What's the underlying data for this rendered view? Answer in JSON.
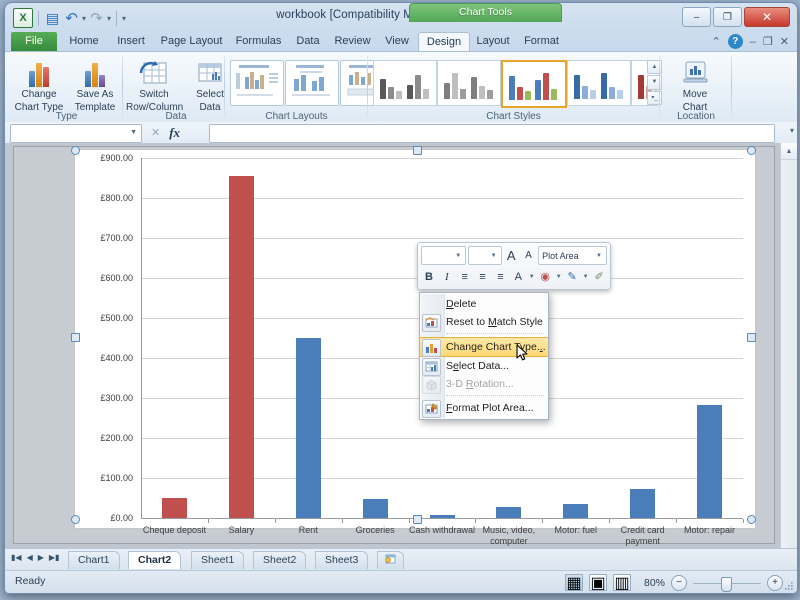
{
  "window": {
    "title": "workbook  [Compatibility Mode]  -  Microsoft Excel",
    "contextual_tab_group": "Chart Tools",
    "quick_access": [
      {
        "name": "excel-logo",
        "glyph": "X"
      },
      {
        "name": "save-icon",
        "glyph": "▤"
      },
      {
        "name": "undo-icon",
        "glyph": "↶"
      },
      {
        "name": "redo-icon",
        "glyph": "↷"
      },
      {
        "name": "customize-qat-icon",
        "glyph": "▾"
      }
    ],
    "controls": [
      {
        "name": "minimize-button",
        "glyph": "–"
      },
      {
        "name": "restore-button",
        "glyph": "❐"
      },
      {
        "name": "close-button",
        "glyph": "✕"
      }
    ],
    "ribbon_right": [
      {
        "name": "minimize-ribbon-icon",
        "glyph": "⌃"
      },
      {
        "name": "help-icon",
        "glyph": "?"
      },
      {
        "name": "window-minimize-icon",
        "glyph": "–"
      },
      {
        "name": "window-restore-icon",
        "glyph": "❐"
      },
      {
        "name": "window-close-icon",
        "glyph": "✕"
      }
    ]
  },
  "tabs": [
    {
      "label": "File",
      "state": "file"
    },
    {
      "label": "Home",
      "state": "normal"
    },
    {
      "label": "Insert",
      "state": "normal"
    },
    {
      "label": "Page Layout",
      "state": "normal"
    },
    {
      "label": "Formulas",
      "state": "normal"
    },
    {
      "label": "Data",
      "state": "normal"
    },
    {
      "label": "Review",
      "state": "normal"
    },
    {
      "label": "View",
      "state": "normal"
    },
    {
      "label": "Design",
      "state": "active"
    },
    {
      "label": "Layout",
      "state": "normal"
    },
    {
      "label": "Format",
      "state": "normal"
    }
  ],
  "ribbon": {
    "groups": [
      {
        "label": "Type",
        "buttons": [
          {
            "name": "change-chart-type-button",
            "line1": "Change",
            "line2": "Chart Type"
          },
          {
            "name": "save-as-template-button",
            "line1": "Save As",
            "line2": "Template"
          }
        ]
      },
      {
        "label": "Data",
        "buttons": [
          {
            "name": "switch-row-column-button",
            "line1": "Switch",
            "line2": "Row/Column"
          },
          {
            "name": "select-data-button",
            "line1": "Select",
            "line2": "Data"
          }
        ]
      },
      {
        "label": "Chart Layouts",
        "buttons": []
      },
      {
        "label": "Chart Styles",
        "buttons": []
      },
      {
        "label": "Location",
        "buttons": [
          {
            "name": "move-chart-button",
            "line1": "Move",
            "line2": "Chart"
          }
        ]
      }
    ]
  },
  "formula_bar": {
    "name_box_value": "",
    "formula_value": "",
    "fx_label": "fx",
    "cancel_glyph": "✕",
    "enter_glyph": "✓",
    "expand_glyph": "▾"
  },
  "mini_toolbar": {
    "font_name": "",
    "font_size": "",
    "grow_font": "A",
    "shrink_font": "A",
    "shape_selector": "Plot Area",
    "bold": "B",
    "italic": "I",
    "align_left": "≡",
    "align_center": "≡",
    "align_right": "≡",
    "font_color": "A",
    "fill_color": "◉",
    "shape_outline": "✎",
    "format_painter": "✐"
  },
  "context_menu": {
    "items": [
      {
        "name": "menu-item-delete",
        "label": "Delete",
        "accel_index": 0,
        "icon": "",
        "state": "normal",
        "separator_after": false
      },
      {
        "name": "menu-item-reset-to-match-style",
        "label": "Reset to Match Style",
        "accel_index": 9,
        "icon": "reset-style-icon",
        "state": "normal",
        "separator_after": true
      },
      {
        "name": "menu-item-change-chart-type",
        "label": "Change Chart Type...",
        "accel_index": 18,
        "icon": "chart-type-icon",
        "state": "highlighted",
        "separator_after": false
      },
      {
        "name": "menu-item-select-data",
        "label": "Select Data...",
        "accel_index": 1,
        "icon": "select-data-icon",
        "state": "normal",
        "separator_after": false
      },
      {
        "name": "menu-item-3d-rotation",
        "label": "3-D Rotation...",
        "accel_index": 4,
        "icon": "cube-icon",
        "state": "disabled",
        "separator_after": true
      },
      {
        "name": "menu-item-format-plot-area",
        "label": "Format Plot Area...",
        "accel_index": 0,
        "icon": "format-icon",
        "state": "normal",
        "separator_after": false
      }
    ]
  },
  "chart_data": {
    "type": "bar",
    "title": "",
    "xlabel": "",
    "ylabel": "",
    "ylim": [
      0,
      900
    ],
    "ytick_step": 100,
    "grid": true,
    "legend": "none",
    "currency_symbol": "£",
    "ytick_labels": [
      "£900.00",
      "£800.00",
      "£700.00",
      "£600.00",
      "£500.00",
      "£400.00",
      "£300.00",
      "£200.00",
      "£100.00",
      "£0.00"
    ],
    "categories": [
      "Cheque deposit",
      "Salary",
      "Rent",
      "Groceries",
      "Cash withdrawal",
      "Music, video, computer",
      "Motor: fuel",
      "Credit card payment",
      "Motor: repair"
    ],
    "values": [
      50,
      855,
      450,
      48,
      8,
      27,
      36,
      72,
      282
    ],
    "point_colors": [
      "#c0504d",
      "#c0504d",
      "#4a7ebb",
      "#4a7ebb",
      "#4a7ebb",
      "#4a7ebb",
      "#4a7ebb",
      "#4a7ebb",
      "#4a7ebb"
    ],
    "colors": {
      "positive": "#4a7ebb",
      "negative": "#c0504d",
      "gridline": "#d4d4d4",
      "axis": "#9a9a9a"
    }
  },
  "sheet_tabs": {
    "nav": [
      "◀▐",
      "◀",
      "▶",
      "▌▶"
    ],
    "tabs": [
      {
        "label": "Chart1",
        "active": false
      },
      {
        "label": "Chart2",
        "active": true
      },
      {
        "label": "Sheet1",
        "active": false
      },
      {
        "label": "Sheet2",
        "active": false
      },
      {
        "label": "Sheet3",
        "active": false
      }
    ],
    "insert_sheet_icon": "insert-worksheet-icon"
  },
  "status_bar": {
    "mode": "Ready",
    "views": [
      {
        "name": "normal-view-button",
        "glyph": "▦",
        "active": true
      },
      {
        "name": "page-layout-view-button",
        "glyph": "▣",
        "active": false
      },
      {
        "name": "page-break-preview-button",
        "glyph": "▥",
        "active": false
      }
    ],
    "zoom_level": "80%",
    "zoom_out": "−",
    "zoom_in": "+"
  }
}
